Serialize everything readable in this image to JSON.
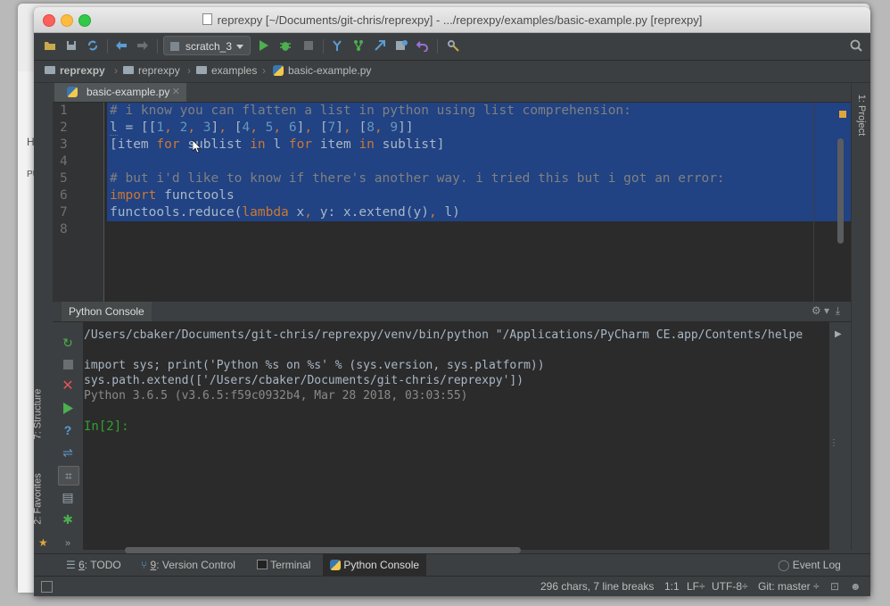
{
  "window": {
    "title": "reprexpy [~/Documents/git-chris/reprexpy] - .../reprexpy/examples/basic-example.py [reprexpy]"
  },
  "background": {
    "label_he": "He",
    "label_pu": "PU"
  },
  "toolbar": {
    "run_config": "scratch_3",
    "icons": [
      "open-icon",
      "save-icon",
      "sync-icon",
      "back-icon",
      "forward-icon",
      "run-icon",
      "debug-icon",
      "stop-icon",
      "vcs-update-icon",
      "vcs-branch-icon",
      "vcs-push-icon",
      "vcs-commit-icon",
      "revert-icon",
      "settings-icon",
      "search-icon"
    ]
  },
  "breadcrumbs": [
    "reprexpy",
    "reprexpy",
    "examples",
    "basic-example.py"
  ],
  "editor": {
    "tab": "basic-example.py",
    "line_numbers": [
      "1",
      "2",
      "3",
      "4",
      "5",
      "6",
      "7",
      "8"
    ]
  },
  "side_tabs": {
    "project": "1: Project",
    "structure": "7: Structure",
    "favorites": "2: Favorites"
  },
  "console": {
    "header": "Python Console",
    "lines": [
      "/Users/cbaker/Documents/git-chris/reprexpy/venv/bin/python \"/Applications/PyCharm CE.app/Contents/helpe",
      "",
      "import sys; print('Python %s on %s' % (sys.version, sys.platform))",
      "sys.path.extend(['/Users/cbaker/Documents/git-chris/reprexpy'])",
      "Python 3.6.5 (v3.6.5:f59c0932b4, Mar 28 2018, 03:03:55)"
    ],
    "prompt": "In[2]:"
  },
  "bottom_tabs": {
    "todo_num": "6",
    "todo": ": TODO",
    "vc_num": "9",
    "vc": ": Version Control",
    "terminal": "Terminal",
    "python_console": "Python Console",
    "event_log": "Event Log"
  },
  "status": {
    "chars": "296 chars, 7 line breaks",
    "pos": "1:1",
    "lf": "LF÷",
    "enc": "UTF-8÷",
    "git": "Git: master ÷"
  },
  "colors": {
    "editor_bg": "#2b2b2b",
    "selection": "#214283",
    "keyword": "#cc7832",
    "number": "#6897bb",
    "comment": "#808080",
    "string": "#6a8759",
    "prompt": "#2fa12f"
  }
}
